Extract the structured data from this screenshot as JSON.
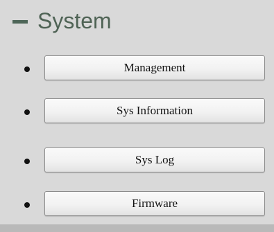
{
  "section": {
    "title": "System",
    "collapse_icon": "minus-icon",
    "accent_color": "#4f6355"
  },
  "menu": {
    "items": [
      {
        "label": "Management"
      },
      {
        "label": "Sys Information"
      },
      {
        "label": "Sys Log"
      },
      {
        "label": "Firmware"
      }
    ]
  }
}
